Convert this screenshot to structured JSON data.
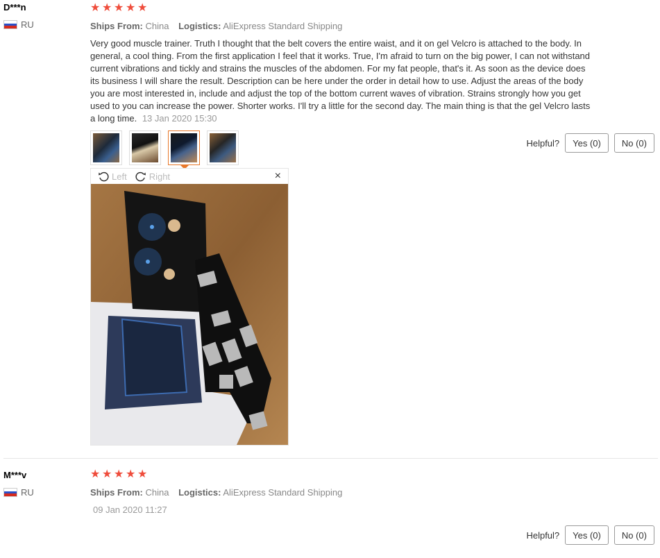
{
  "reviews": [
    {
      "user": "D***n",
      "country": "RU",
      "stars": [
        "★",
        "★",
        "★",
        "★",
        "★"
      ],
      "ships_from_label": "Ships From:",
      "ships_from": "China",
      "logistics_label": "Logistics:",
      "logistics": "AliExpress Standard Shipping",
      "text": "Very good muscle trainer. Truth I thought that the belt covers the entire waist, and it on gel Velcro is attached to the body. In general, a cool thing. From the first application I feel that it works. True, I'm afraid to turn on the big power, I can not withstand current vibrations and tickly and strains the muscles of the abdomen. For my fat people, that's it. As soon as the device does its business I will share the result. Description can be here under the order in detail how to use. Adjust the areas of the body you are most interested in, include and adjust the top of the bottom current waves of vibration. Strains strongly how you get used to you can increase the power. Shorter works. I'll try a little for the second day. The main thing is that the gel Velcro lasts a long time.",
      "date": "13 Jan 2020 15:30",
      "helpful_label": "Helpful?",
      "yes_label": "Yes (0)",
      "no_label": "No (0)",
      "viewer": {
        "left_label": "Left",
        "right_label": "Right",
        "close": "×"
      }
    },
    {
      "user": "M***v",
      "country": "RU",
      "stars": [
        "★",
        "★",
        "★",
        "★",
        "★"
      ],
      "ships_from_label": "Ships From:",
      "ships_from": "China",
      "logistics_label": "Logistics:",
      "logistics": "AliExpress Standard Shipping",
      "date": "09 Jan 2020 11:27",
      "helpful_label": "Helpful?",
      "yes_label": "Yes (0)",
      "no_label": "No (0)"
    }
  ],
  "colors": {
    "star": "#ef4c3b",
    "active_thumb": "#e8782a"
  },
  "icons": [
    "rotate-left-icon",
    "rotate-right-icon",
    "close-icon",
    "star-icon",
    "flag-ru-icon"
  ]
}
